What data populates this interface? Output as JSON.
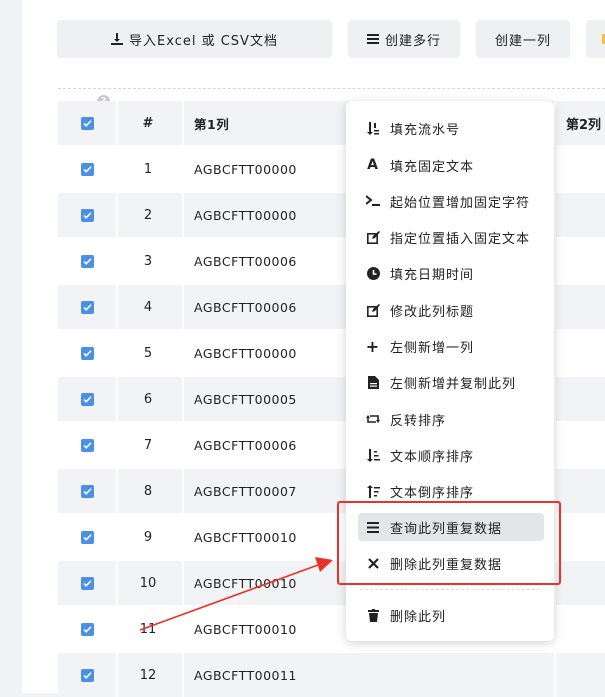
{
  "toolbar": {
    "import_label": "导入Excel 或 CSV文档",
    "multi_row_label": "创建多行",
    "one_col_label": "创建一列"
  },
  "table": {
    "help_mark": "?",
    "header": {
      "num": "#",
      "col1": "第1列",
      "col2": "第2列"
    },
    "rows": [
      {
        "num": "1",
        "c1": "AGBCFTT00000"
      },
      {
        "num": "2",
        "c1": "AGBCFTT00000"
      },
      {
        "num": "3",
        "c1": "AGBCFTT00006"
      },
      {
        "num": "4",
        "c1": "AGBCFTT00006"
      },
      {
        "num": "5",
        "c1": "AGBCFTT00000"
      },
      {
        "num": "6",
        "c1": "AGBCFTT00005"
      },
      {
        "num": "7",
        "c1": "AGBCFTT00006"
      },
      {
        "num": "8",
        "c1": "AGBCFTT00007"
      },
      {
        "num": "9",
        "c1": "AGBCFTT00010"
      },
      {
        "num": "10",
        "c1": "AGBCFTT00010"
      },
      {
        "num": "11",
        "c1": "AGBCFTT00010"
      },
      {
        "num": "12",
        "c1": "AGBCFTT00011"
      }
    ]
  },
  "menu": {
    "items": [
      {
        "label": "填充流水号",
        "icon": "sort-numeric-icon"
      },
      {
        "label": "填充固定文本",
        "icon": "font-icon"
      },
      {
        "label": "起始位置增加固定字符",
        "icon": "terminal-icon"
      },
      {
        "label": "指定位置插入固定文本",
        "icon": "edit-icon"
      },
      {
        "label": "填充日期时间",
        "icon": "clock-icon"
      },
      {
        "label": "修改此列标题",
        "icon": "edit-icon"
      },
      {
        "label": "左侧新增一列",
        "icon": "plus-icon"
      },
      {
        "label": "左侧新增并复制此列",
        "icon": "file-icon"
      },
      {
        "label": "反转排序",
        "icon": "retweet-icon"
      },
      {
        "label": "文本顺序排序",
        "icon": "sort-asc-icon"
      },
      {
        "label": "文本倒序排序",
        "icon": "sort-desc-icon"
      },
      {
        "label": "查询此列重复数据",
        "icon": "bars-icon"
      },
      {
        "label": "删除此列重复数据",
        "icon": "times-icon"
      },
      {
        "label": "删除此列",
        "icon": "trash-icon"
      }
    ]
  },
  "colors": {
    "accent": "#4a8fe8",
    "highlight": "#e8322b"
  }
}
